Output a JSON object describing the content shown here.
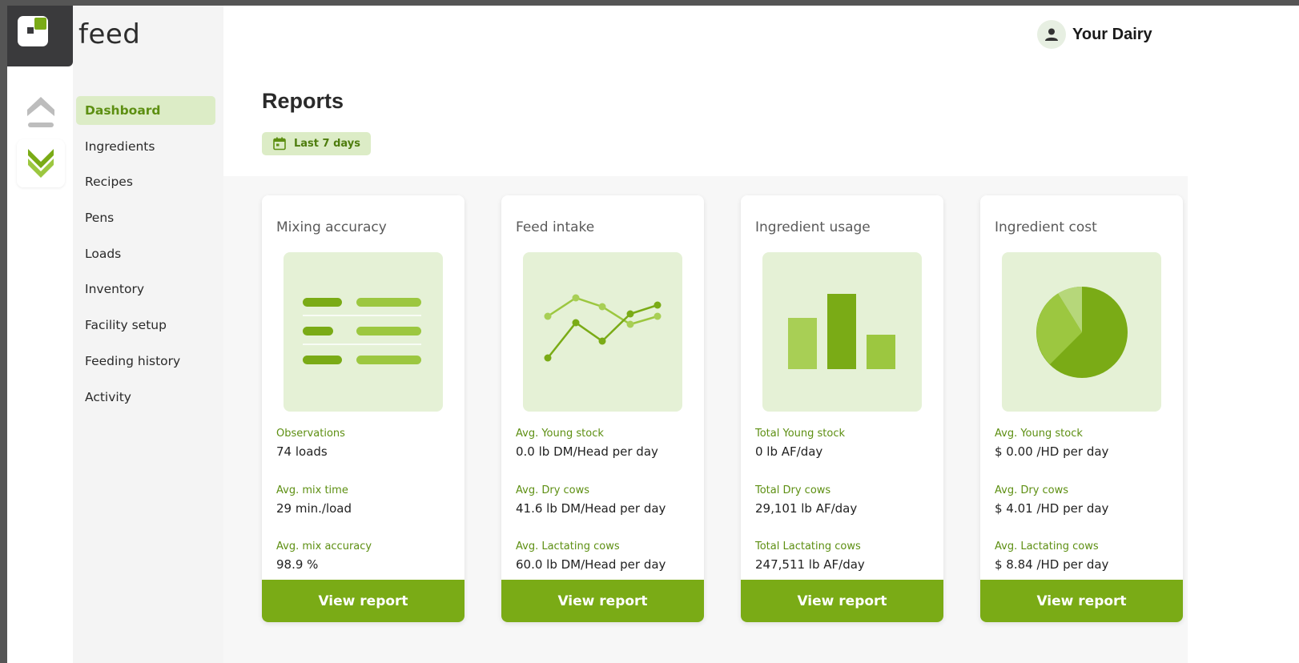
{
  "brand": {
    "name": "feed"
  },
  "rail": {
    "icons": [
      "chevron-up-icon",
      "feed-chevron-icon"
    ]
  },
  "sidebar": {
    "items": [
      {
        "label": "Dashboard",
        "active": true
      },
      {
        "label": "Ingredients"
      },
      {
        "label": "Recipes"
      },
      {
        "label": "Pens"
      },
      {
        "label": "Loads"
      },
      {
        "label": "Inventory"
      },
      {
        "label": "Facility setup"
      },
      {
        "label": "Feeding history"
      },
      {
        "label": "Activity"
      }
    ]
  },
  "header": {
    "user_name": "Your Dairy"
  },
  "page": {
    "title": "Reports",
    "date_filter": "Last 7 days"
  },
  "colors": {
    "accent": "#7aab16",
    "accent_light": "#dcecc6",
    "tile_bg": "#e5f1d6"
  },
  "cards": [
    {
      "title": "Mixing accuracy",
      "icon": "list-illustration",
      "stats": [
        {
          "label": "Observations",
          "value": "74 loads"
        },
        {
          "label": "Avg. mix time",
          "value": "29 min./load"
        },
        {
          "label": "Avg. mix accuracy",
          "value": "98.9 %"
        }
      ],
      "button": "View report"
    },
    {
      "title": "Feed intake",
      "icon": "line-chart-illustration",
      "stats": [
        {
          "label": "Avg. Young stock",
          "value": "0.0 lb DM/Head per day"
        },
        {
          "label": "Avg. Dry cows",
          "value": "41.6 lb DM/Head per day"
        },
        {
          "label": "Avg. Lactating cows",
          "value": "60.0 lb DM/Head per day"
        }
      ],
      "button": "View report"
    },
    {
      "title": "Ingredient usage",
      "icon": "bar-chart-illustration",
      "stats": [
        {
          "label": "Total Young stock",
          "value": "0 lb AF/day"
        },
        {
          "label": "Total Dry cows",
          "value": "29,101 lb AF/day"
        },
        {
          "label": "Total Lactating cows",
          "value": "247,511 lb AF/day"
        }
      ],
      "button": "View report"
    },
    {
      "title": "Ingredient cost",
      "icon": "pie-chart-illustration",
      "stats": [
        {
          "label": "Avg. Young stock",
          "value": "$ 0.00 /HD per day"
        },
        {
          "label": "Avg. Dry cows",
          "value": "$ 4.01 /HD per day"
        },
        {
          "label": "Avg. Lactating cows",
          "value": "$ 8.84 /HD per day"
        }
      ],
      "button": "View report"
    }
  ]
}
